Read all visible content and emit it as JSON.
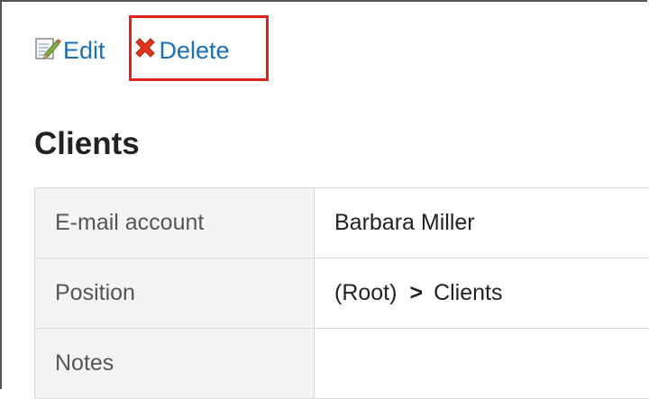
{
  "toolbar": {
    "edit_label": "Edit",
    "edit_icon": "edit-icon",
    "delete_label": "Delete",
    "delete_icon": "delete-x-icon",
    "link_color": "#1a6fb9",
    "highlight_color": "#e2201c"
  },
  "page": {
    "title": "Clients"
  },
  "details": {
    "rows": [
      {
        "label": "E-mail account",
        "value": "Barbara Miller"
      },
      {
        "label": "Position",
        "path_root": "(Root)",
        "path_separator": ">",
        "path_leaf": "Clients"
      },
      {
        "label": "Notes",
        "value": ""
      }
    ]
  }
}
